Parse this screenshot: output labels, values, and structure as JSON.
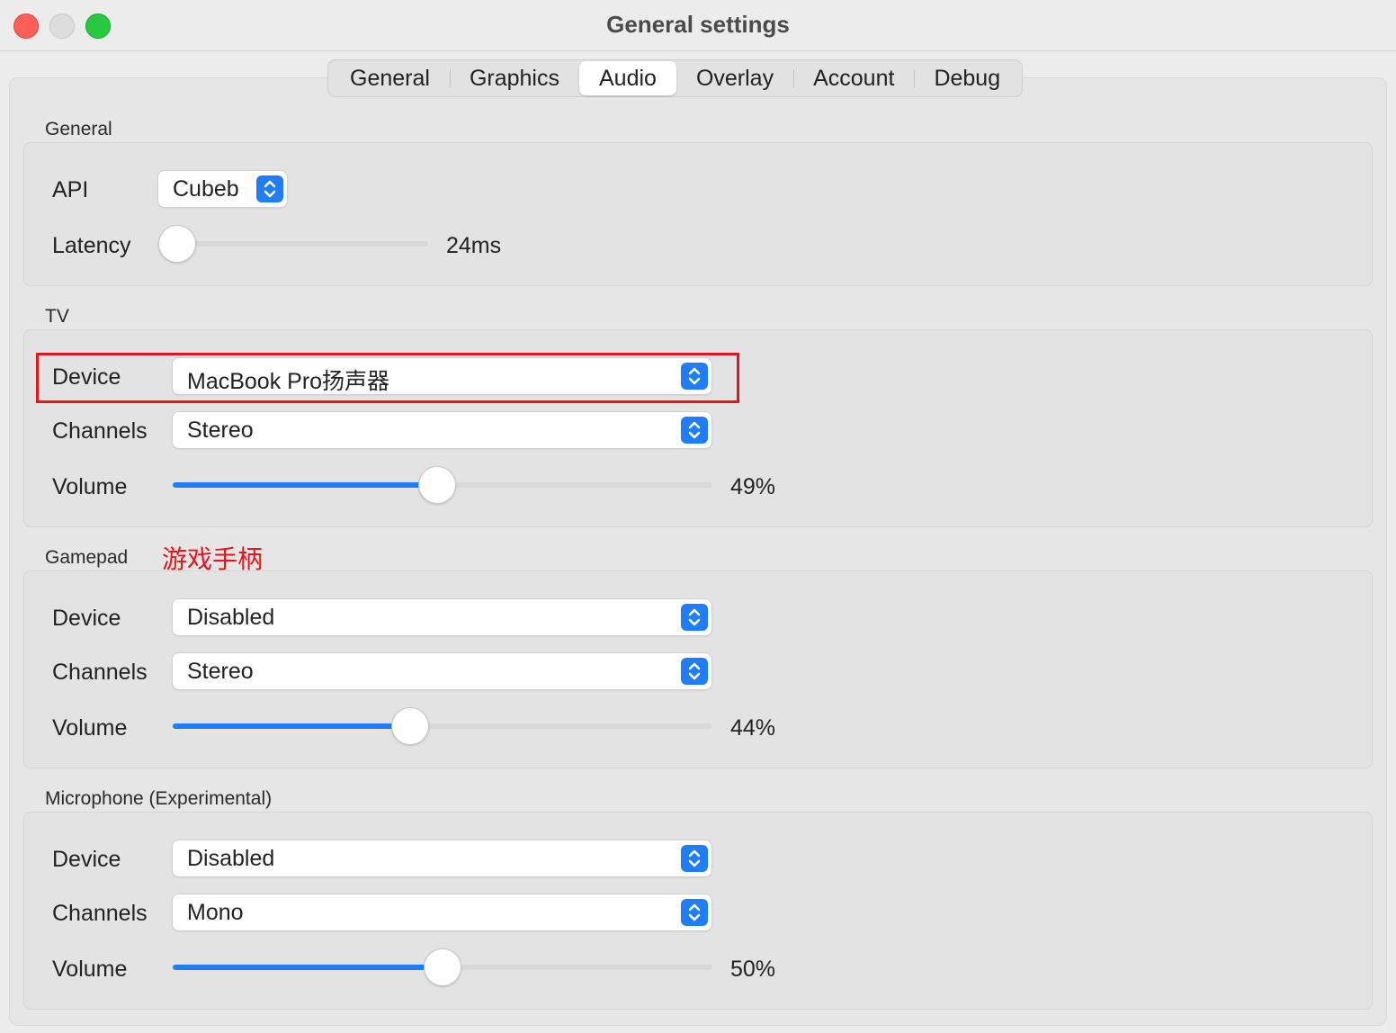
{
  "window": {
    "title": "General settings"
  },
  "tabs": [
    {
      "label": "General",
      "active": false
    },
    {
      "label": "Graphics",
      "active": false
    },
    {
      "label": "Audio",
      "active": true
    },
    {
      "label": "Overlay",
      "active": false
    },
    {
      "label": "Account",
      "active": false
    },
    {
      "label": "Debug",
      "active": false
    }
  ],
  "general": {
    "title": "General",
    "api": {
      "label": "API",
      "value": "Cubeb"
    },
    "latency": {
      "label": "Latency",
      "value_text": "24ms",
      "fraction": 0.07
    }
  },
  "tv": {
    "title": "TV",
    "device": {
      "label": "Device",
      "value": "MacBook Pro扬声器"
    },
    "channels": {
      "label": "Channels",
      "value": "Stereo"
    },
    "volume": {
      "label": "Volume",
      "value_text": "49%",
      "fraction": 0.49
    }
  },
  "gamepad": {
    "title": "Gamepad",
    "annotation": "游戏手柄",
    "device": {
      "label": "Device",
      "value": "Disabled"
    },
    "channels": {
      "label": "Channels",
      "value": "Stereo"
    },
    "volume": {
      "label": "Volume",
      "value_text": "44%",
      "fraction": 0.44
    }
  },
  "microphone": {
    "title": "Microphone (Experimental)",
    "device": {
      "label": "Device",
      "value": "Disabled"
    },
    "channels": {
      "label": "Channels",
      "value": "Mono"
    },
    "volume": {
      "label": "Volume",
      "value_text": "50%",
      "fraction": 0.5
    }
  },
  "colors": {
    "accent": "#1f7dfa",
    "highlight": "#e8141c"
  }
}
